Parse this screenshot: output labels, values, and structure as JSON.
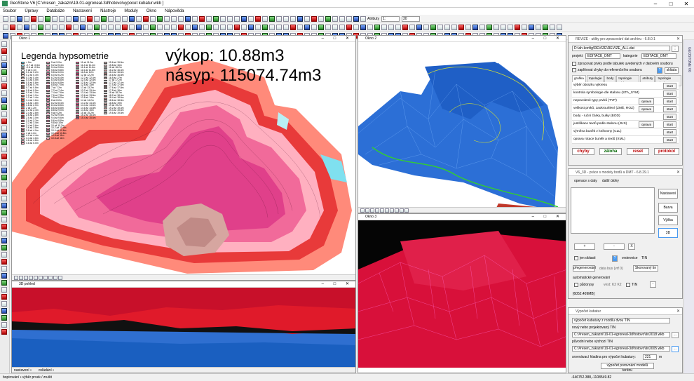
{
  "app": {
    "title": "GeoStone V6 [C:\\#resen_zakazni\\19-01-egroneal-3d\\hotovo\\vypocet kubatur.wkb ]",
    "status_left": "bopirování • výběr prvek / zrušit",
    "status_coords": "-646752.388,-1108549.82"
  },
  "menu": [
    "Soubor",
    "Úpravy",
    "Databáze",
    "Nastavení",
    "Nástroje",
    "Moduly",
    "Okno",
    "Nápověda"
  ],
  "toolbar": {
    "layer_label": "Atributy",
    "scale_value": "1:",
    "zoom_value": "30"
  },
  "window1": {
    "title": "Okno 1",
    "legend_title": "Legenda hypsometrie",
    "excavation_text": "výkop: 10.88m3",
    "fill_text": "násyp: 115074.74m3"
  },
  "window2": {
    "title": "Okno 2"
  },
  "window3": {
    "title": "Okno 3"
  },
  "window3d": {
    "title": "3D pohled",
    "foot_a": "nastavení •",
    "foot_b": "ovládání •"
  },
  "legend_items": [
    [
      "< 0m",
      "#3cc7e8"
    ],
    [
      "-0.7 až -0.6m",
      "#7fe0ef"
    ],
    [
      "-0.6 až -0.5m",
      "#b8f0f5"
    ],
    [
      "0 až 0.1m",
      "#fff4f0"
    ],
    [
      "0.1 až 0.2m",
      "#ffe6e0"
    ],
    [
      "0.2 až 0.3m",
      "#ffd8cf"
    ],
    [
      "0.3 až 0.4m",
      "#ffcabf"
    ],
    [
      "0.4 až 0.5m",
      "#ffbcae"
    ],
    [
      "0.5 až 0.6m",
      "#ffae9e"
    ],
    [
      "0.6 až 0.7m",
      "#ffa08e"
    ],
    [
      "0.7 až 0.8m",
      "#ff927e"
    ],
    [
      "0.8 až 0.9m",
      "#ff846e"
    ],
    [
      "0.9 až 1.0m",
      "#ff765e"
    ],
    [
      "1.0 až 1.2m",
      "#fb6a55"
    ],
    [
      "1.2 až 1.4m",
      "#f75f4d"
    ],
    [
      "1.4 až 1.6m",
      "#f25445"
    ],
    [
      "1.6 až 1.8m",
      "#ec4a3e"
    ],
    [
      "1.8 až 2.0m",
      "#e64037"
    ],
    [
      "2 až 2.2m",
      "#e03630"
    ],
    [
      "2.2 až 2.4m",
      "#da2d2a"
    ],
    [
      "2.4 až 2.6m",
      "#d42424"
    ],
    [
      "2.6 až 2.8m",
      "#ce1c1f"
    ],
    [
      "2.8 až 3.0m",
      "#f05070"
    ],
    [
      "3.0 až 3.2m",
      "#f15a78"
    ],
    [
      "3.2 až 3.4m",
      "#f26480"
    ],
    [
      "3.4 až 3.6m",
      "#f36e88"
    ],
    [
      "3.6 až 3.8m",
      "#f47890"
    ],
    [
      "3.8 až 4.0m",
      "#f58298"
    ],
    [
      "4 až 4.2m",
      "#f68ca0"
    ],
    [
      "4.2 až 4.4m",
      "#f796a8"
    ],
    [
      "4.4 až 4.6m",
      "#f8a0b0"
    ],
    [
      "4.6 až 4.8m",
      "#f9aab8"
    ],
    [
      "4.8 až 5.0m",
      "#faa4c0"
    ]
  ],
  "legend_col2": [
    "5 až 5.2m",
    "5.2 až 5.4m",
    "5.4 až 5.6m",
    "5.6 až 5.8m",
    "5.8 až 6.0m",
    "6.0 až 6.2m",
    "6.2 až 6.4m",
    "6.4 až 6.6m",
    "6.6 až 6.8m",
    "6.8 až 7.0m",
    "7 až 7.2m",
    "7.2 až 7.4m",
    "7.4 až 7.6m",
    "7.6 až 7.8m",
    "7.8 až 8.0m",
    "8 až 8.2m",
    "8.2 až 8.4m",
    "8.4 až 8.6m",
    "8.6 až 8.8m",
    "8.8 až 9.0m",
    "9 až 9.2m",
    "9.2 až 9.4m",
    "9.4 až 9.6m",
    "9.6 až 9.8m",
    "9.8 až 10m",
    "10 až 10.2m",
    "10.2 až 10.4m",
    "10.4 až 10.6m",
    "10.6 až 10.8m",
    "10.8 až 11m",
    "10.8 až 11m"
  ],
  "legend_col3": [
    "11 až 11.2m",
    "11.2 až 11.4m",
    "11.4 až 11.6m",
    "11.6 až 11.8m",
    "11.8 až 12m",
    "12 až 12.2m",
    "12.2 až 12.4m",
    "12.4 až 12.6m",
    "12.6 až 12.8m",
    "12.8 až 13m",
    "13 až 13.2m",
    "13.2 až 13.4m",
    "13.4 až 13.6m",
    "13.6 až 13.8m",
    "13.8 až 14m",
    "14 až 14.2m",
    "14.2 až 14.4m",
    "14.4 až 14.6m",
    "14.6 až 14.8m",
    "14.8 až 15m",
    "15 až 15.2m",
    "15.2 až 15.4m",
    "15.4 až 15.6m"
  ],
  "legend_col4": [
    "15.6 až 15.8m",
    "15.8 až 16m",
    "16 až 16.2m",
    "16.2 až 16.4m",
    "16.4 až 16.6m",
    "16.6 až 16.8m",
    "16.8 až 17m",
    "17 až 17.2m",
    "17.2 až 17.4m",
    "17.4 až 17.6m",
    "17.6 až 17.8m",
    "17.8 až 18m",
    "18 až 18.2m",
    "18.2 až 18.4m",
    "18.4 až 18.6m",
    "18.6 až 18.8m",
    "18.8 až 19m",
    "19 až 19.2m",
    "19.2 až 19.4m",
    "19.4 až 19.6m",
    "19.6 až 19.8m"
  ],
  "revize": {
    "title": "REVIZE - utility pro zpracování dat archivu - 6.8.0.1",
    "path": "D:\\ah-konfig\\REVIZE\\REVIZE_ALL.dat",
    "projekt_label": "projekt",
    "projekt_value": "EDITACE_DMT",
    "kategorie_label": "kategorie",
    "kategorie_value": "EDITACE_DMT",
    "opt1": "zpracovat prvky podle tabulek uvedených v datovém souboru",
    "opt2": "zaplňovat chyby do referenčního souboru",
    "help": "?",
    "sklada": "skláda",
    "tabs": [
      "grafika",
      "topologie",
      "body",
      "topologie vrbl",
      "atributy",
      "topologie ploch"
    ],
    "rows": [
      {
        "label": "výběr obrazku výkresu",
        "fix": "",
        "start": "start"
      },
      {
        "label": "kontrola symbologie dle stalonu (STA_SYM)",
        "fix": "",
        "start": "start"
      },
      {
        "label": "nepovolené typy prvků (TYP)",
        "fix": "oprava",
        "start": "start"
      },
      {
        "label": "velikost prvků, zaokrouhlení (ZMĚ, ROZ)",
        "fix": "oprava",
        "start": "start"
      },
      {
        "label": "body - ruční čárky, bulky (BOD)",
        "fix": "",
        "start": "start"
      },
      {
        "label": "justifikace textů podle stalonu (JUS)",
        "fix": "oprava",
        "start": "start"
      },
      {
        "label": "výměna buněk z knihovny (CLL)",
        "fix": "",
        "start": "start"
      },
      {
        "label": "oprava rotace buněk a textů (XML)",
        "fix": "",
        "start": "start"
      }
    ],
    "btn_chyby": "chyby",
    "btn_zaloha": "záloha",
    "btn_reset": "reset",
    "btn_protokol": "protokol"
  },
  "v63d": {
    "title": "V6_3D - práce s modely bodů a DMT - 6.8.29.1",
    "tab1": "operace s daty",
    "tab2": "další úlohy",
    "btn_nastaveni": "Nastavení",
    "btn_barva": "Barva",
    "btn_vyska": "Výška",
    "btn_3d": "3D",
    "plus": "+",
    "minus": "-",
    "x_btn": "X",
    "jen_oblasti": "jen oblasti",
    "help": "?",
    "vrstevnice": "vrstevnice",
    "tin": "TIN",
    "pregenerovani": "přegenerování",
    "data_bus": "data bus (vrf 0)",
    "skorovany_tin": "Skorovaný tin",
    "auto_gen": "automatické generování",
    "pudorysy": "půdorysy",
    "vest": "vest: K2 K2",
    "tin2": "TIN",
    "footer": "[6052.409MB]"
  },
  "kubatury": {
    "title": "Výpočet kubatur",
    "method": "výpočet kubatury z rozdílu dvou TIN",
    "new_label": "nový nebo projektovaný TIN",
    "new_path": "C:\\#resen_zakazni\\19-01-egroneal-3d\\hotovo\\tin2018.wkb",
    "old_label": "původní nebo výchozí TIN",
    "old_path": "C:\\#resen_zakazni\\19-01-egroneal-3d\\hotovo\\tin2005.wkb",
    "level_label": "srovnávací hladina pro výpočet kubatury:",
    "level_value": "221",
    "unit": "m",
    "compare_btn": "výpočet porovnání modelů terénu",
    "dots": "..."
  }
}
